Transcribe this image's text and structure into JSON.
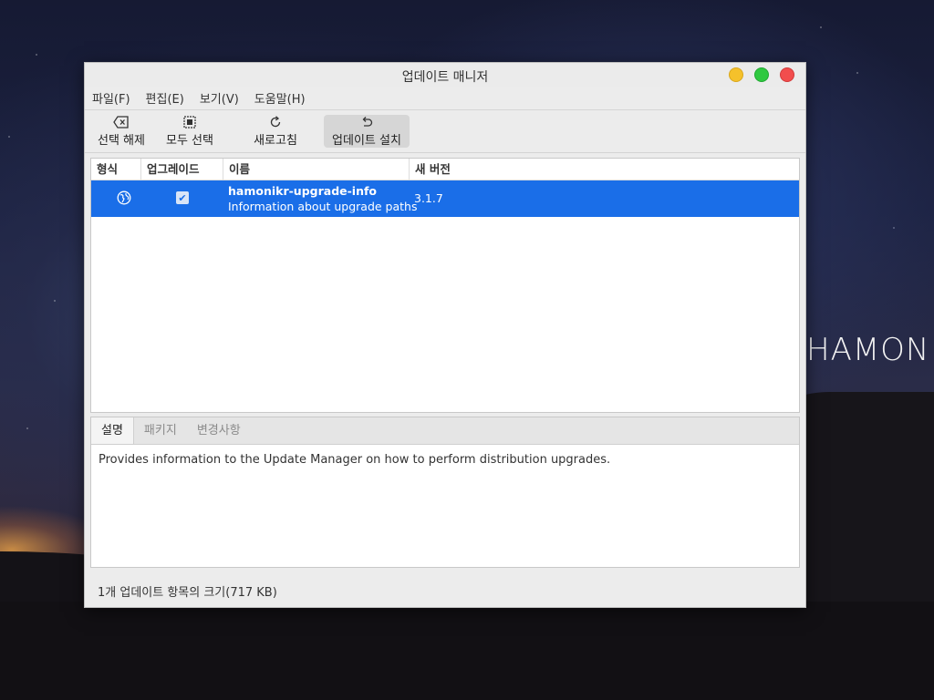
{
  "desktop": {
    "brand_text": "HAMON"
  },
  "window": {
    "title": "업데이트 매니저",
    "menu": [
      "파일(F)",
      "편집(E)",
      "보기(V)",
      "도움말(H)"
    ],
    "toolbar": {
      "deselect_label": "선택 해제",
      "select_all_label": "모두 선택",
      "refresh_label": "새로고침",
      "install_label": "업데이트 설치"
    },
    "list": {
      "columns": [
        "형식",
        "업그레이드",
        "이름",
        "새 버전"
      ],
      "rows": [
        {
          "type_icon": "globe-icon",
          "upgrade_checked": true,
          "name": "hamonikr-upgrade-info",
          "description": "Information about upgrade paths",
          "new_version": "3.1.7"
        }
      ]
    },
    "details": {
      "tabs": [
        "설명",
        "패키지",
        "변경사항"
      ],
      "active_tab": "설명",
      "text": "Provides information to the Update Manager on how to perform distribution upgrades."
    },
    "status": "1개 업데이트 항목의 크기(717 KB)"
  },
  "colors": {
    "selection": "#1a6ee8",
    "minimize": "#f5c12b",
    "maximize": "#2fc940",
    "close": "#f24d4d"
  }
}
